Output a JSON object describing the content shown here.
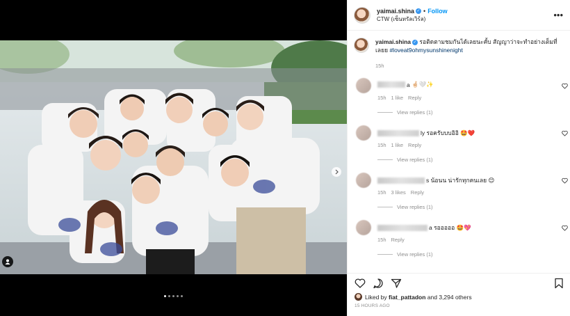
{
  "post": {
    "username": "yaimai.shina",
    "separator": "•",
    "follow_label": "Follow",
    "location": "CTW (เซ็นทรัลเวิร์ล)",
    "more_icon": "more-options-icon",
    "caption_text": "รอติดตามชมกันได้เลยนะคั้บ สัญญาว่าจะทำอย่างเต็มที่เลยย",
    "hashtag": "#loveat9ohmysunshinenight",
    "caption_time": "15h",
    "likes_prefix": "Liked by",
    "liked_by_user": "fiat_pattadon",
    "likes_suffix": "and 3,294 others",
    "timestamp": "15 HOURS AGO",
    "carousel": {
      "count": 5,
      "active": 0
    }
  },
  "comments": [
    {
      "name_suffix": "a",
      "text": "🤞🏻🤍✨",
      "time": "15h",
      "likes": "1 like",
      "reply": "Reply",
      "view_replies": "View replies (1)"
    },
    {
      "name_suffix": "ly",
      "text": "รอครับบบอิอิ 🤩❤️",
      "time": "15h",
      "likes": "1 like",
      "reply": "Reply",
      "view_replies": "View replies (1)"
    },
    {
      "name_suffix": "s",
      "text": "น้อนน น่ารักทุกคนเลย 😊",
      "time": "15h",
      "likes": "3 likes",
      "reply": "Reply",
      "view_replies": "View replies (1)"
    },
    {
      "name_suffix": "a",
      "text": "รอออออ 🤩💖",
      "time": "15h",
      "likes": "",
      "reply": "Reply",
      "view_replies": "View replies (1)"
    }
  ],
  "colors": {
    "accent": "#0095f6",
    "hashtag": "#00376b",
    "muted": "#8e8e8e"
  }
}
